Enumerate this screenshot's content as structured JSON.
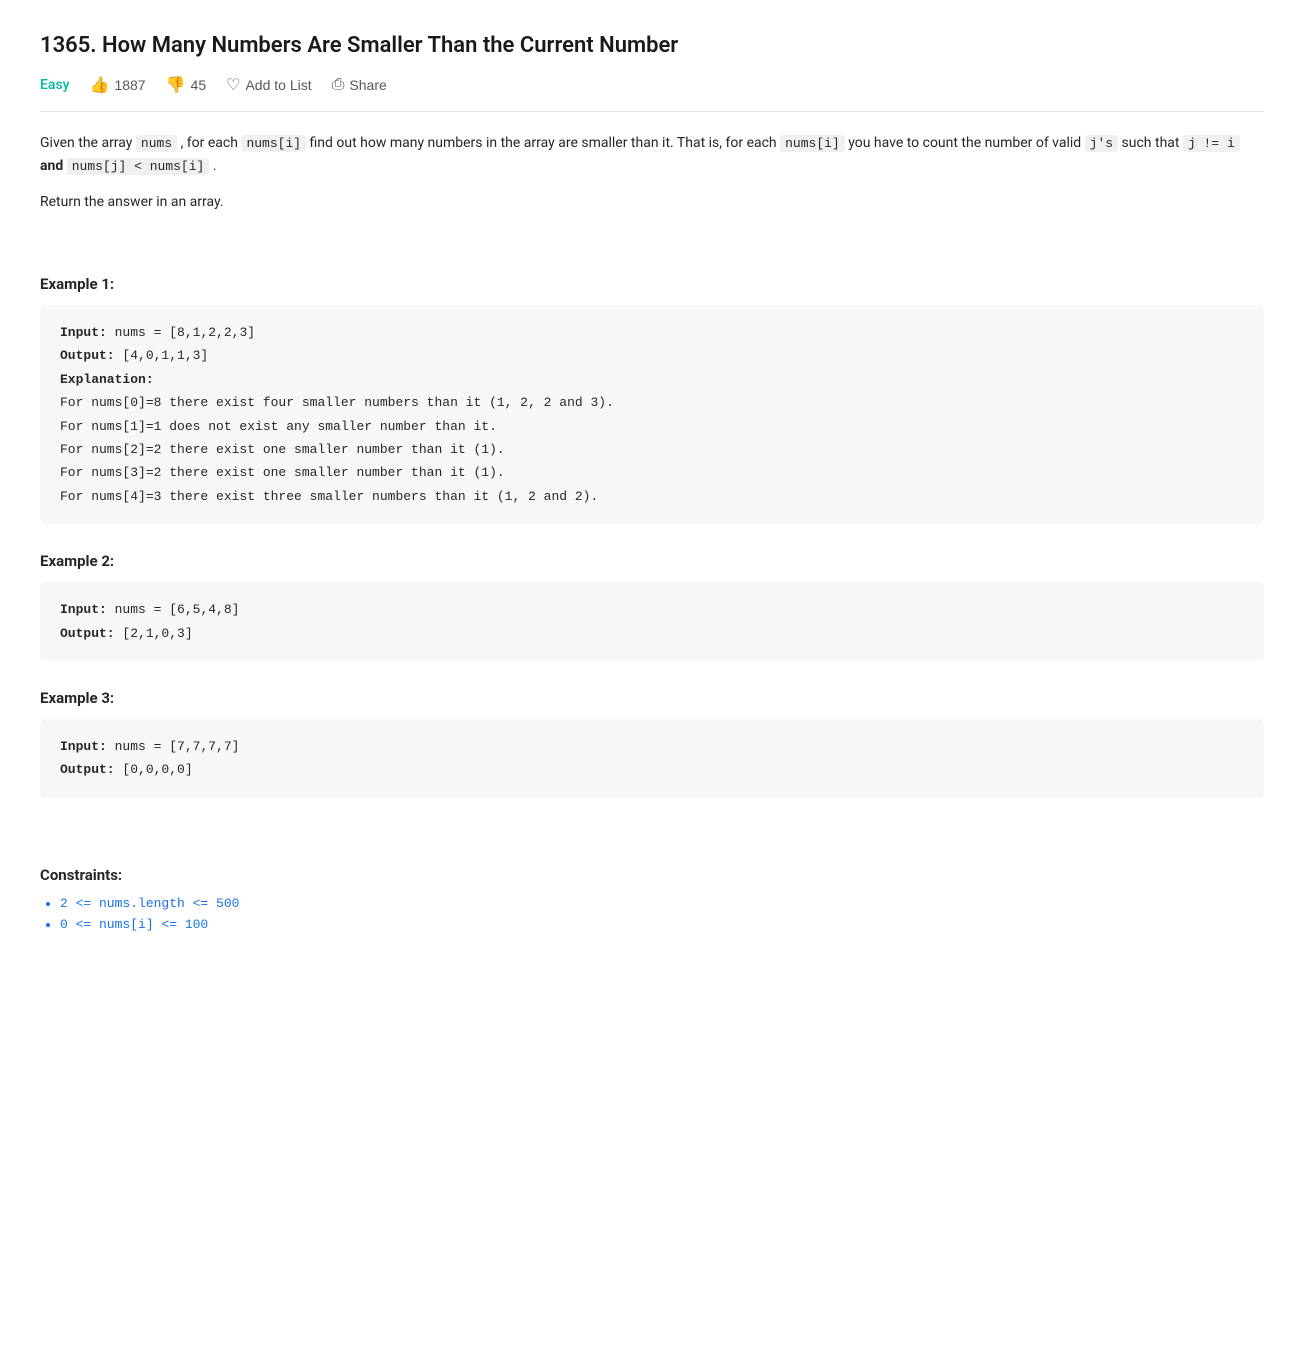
{
  "page": {
    "title": "1365. How Many Numbers Are Smaller Than the Current Number",
    "difficulty": "Easy",
    "likes": "1887",
    "dislikes": "45",
    "addToList": "Add to List",
    "share": "Share",
    "description_part1": "Given the array ",
    "code_nums": "nums",
    "description_part2": ", for each ",
    "code_nums_i": "nums[i]",
    "description_part3": " find out how many numbers in the array are smaller than it. That is, for each ",
    "code_nums_i2": "nums[i]",
    "description_part4": " you have to count the number of valid ",
    "code_js": "j's",
    "description_part5": " such that ",
    "code_j_neq_i": "j != i",
    "description_bold_and": "and",
    "code_nums_j_lt": "nums[j] < nums[i]",
    "description_part6": ".",
    "return_text": "Return the answer in an array.",
    "example1_title": "Example 1:",
    "example1_input_label": "Input:",
    "example1_input_value": "nums = [8,1,2,2,3]",
    "example1_output_label": "Output:",
    "example1_output_value": "[4,0,1,1,3]",
    "example1_explanation_label": "Explanation:",
    "example1_lines": [
      "For nums[0]=8 there exist four smaller numbers than it (1, 2, 2 and 3).",
      "For nums[1]=1 does not exist any smaller number than it.",
      "For nums[2]=2 there exist one smaller number than it (1).",
      "For nums[3]=2 there exist one smaller number than it (1).",
      "For nums[4]=3 there exist three smaller numbers than it (1, 2 and 2)."
    ],
    "example2_title": "Example 2:",
    "example2_input_label": "Input:",
    "example2_input_value": "nums = [6,5,4,8]",
    "example2_output_label": "Output:",
    "example2_output_value": "[2,1,0,3]",
    "example3_title": "Example 3:",
    "example3_input_label": "Input:",
    "example3_input_value": "nums = [7,7,7,7]",
    "example3_output_label": "Output:",
    "example3_output_value": "[0,0,0,0]",
    "constraints_title": "Constraints:",
    "constraint1": "2 <= nums.length <= 500",
    "constraint2": "0 <= nums[i] <= 100"
  }
}
